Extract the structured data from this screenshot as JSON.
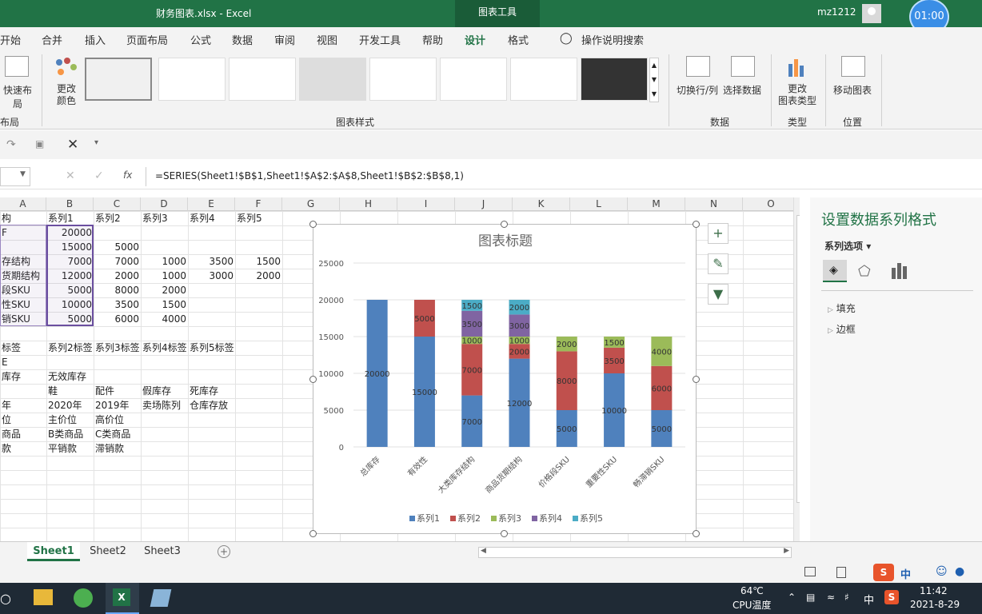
{
  "window": {
    "file_title": "财务图表.xlsx  -  Excel",
    "context_tool": "图表工具",
    "user": "mz1212",
    "timer": "01:00"
  },
  "menu": {
    "items": [
      "开始",
      "插入",
      "页面布局",
      "公式",
      "数据",
      "审阅",
      "视图",
      "开发工具",
      "帮助",
      "设计",
      "格式"
    ],
    "file_item": "开始",
    "merge_item": "合并",
    "tell_me": "操作说明搜索",
    "active": "设计"
  },
  "ribbon": {
    "quick_layout": "快速布局",
    "quick_layout_group": "布局",
    "change_colors": "更改\n颜色",
    "chart_styles_group": "图表样式",
    "switch_row_col": "切换行/列",
    "select_data": "选择数据",
    "data_group": "数据",
    "change_type": "更改\n图表类型",
    "type_group": "类型",
    "move_chart": "移动图表",
    "location_group": "位置"
  },
  "formula": {
    "text": "=SERIES(Sheet1!$B$1,Sheet1!$A$2:$A$8,Sheet1!$B$2:$B$8,1)"
  },
  "columns": [
    "A",
    "B",
    "C",
    "D",
    "E",
    "F",
    "G",
    "H",
    "I",
    "J",
    "K",
    "L",
    "M",
    "N",
    "O"
  ],
  "grid": {
    "rows": [
      [
        "构",
        "系列1",
        "系列2",
        "系列3",
        "系列4",
        "系列5"
      ],
      [
        "F",
        "20000",
        "",
        "",
        "",
        ""
      ],
      [
        "",
        "15000",
        "5000",
        "",
        "",
        ""
      ],
      [
        "存结构",
        "7000",
        "7000",
        "1000",
        "3500",
        "1500"
      ],
      [
        "货期结构",
        "12000",
        "2000",
        "1000",
        "3000",
        "2000"
      ],
      [
        "段SKU",
        "5000",
        "8000",
        "2000",
        "",
        ""
      ],
      [
        "性SKU",
        "10000",
        "3500",
        "1500",
        "",
        ""
      ],
      [
        "销SKU",
        "5000",
        "6000",
        "4000",
        "",
        ""
      ],
      [
        "",
        "",
        "",
        "",
        "",
        ""
      ],
      [
        "标签",
        "系列2标签",
        "系列3标签",
        "系列4标签",
        "系列5标签",
        ""
      ],
      [
        "E",
        "",
        "",
        "",
        "",
        ""
      ],
      [
        "库存",
        "无效库存",
        "",
        "",
        "",
        ""
      ],
      [
        "",
        "鞋",
        "配件",
        "假库存",
        "死库存",
        ""
      ],
      [
        "年",
        "2020年",
        "2019年",
        "卖场陈列",
        "仓库存放",
        ""
      ],
      [
        "位",
        "主价位",
        "高价位",
        "",
        "",
        ""
      ],
      [
        "商品",
        "B类商品",
        "C类商品",
        "",
        "",
        ""
      ],
      [
        "款",
        "平销款",
        "滞销款",
        "",
        "",
        ""
      ]
    ]
  },
  "chart_data": {
    "type": "bar",
    "stacked": true,
    "title": "图表标题",
    "categories": [
      "总库存",
      "有效性",
      "大类库存结构",
      "商品货期结构",
      "价格段SKU",
      "重要性SKU",
      "畅滞销SKU"
    ],
    "series": [
      {
        "name": "系列1",
        "values": [
          20000,
          15000,
          7000,
          12000,
          5000,
          10000,
          5000
        ],
        "color": "#4f81bd"
      },
      {
        "name": "系列2",
        "values": [
          0,
          5000,
          7000,
          2000,
          8000,
          3500,
          6000
        ],
        "color": "#c0504d"
      },
      {
        "name": "系列3",
        "values": [
          0,
          0,
          1000,
          1000,
          2000,
          1500,
          4000
        ],
        "color": "#9bbb59"
      },
      {
        "name": "系列4",
        "values": [
          0,
          0,
          3500,
          3000,
          0,
          0,
          0
        ],
        "color": "#8064a2"
      },
      {
        "name": "系列5",
        "values": [
          0,
          0,
          1500,
          2000,
          0,
          0,
          0
        ],
        "color": "#4bacc6"
      }
    ],
    "y_ticks": [
      "0",
      "5000",
      "10000",
      "15000",
      "20000",
      "25000"
    ],
    "ylim": [
      0,
      25000
    ],
    "grid": true,
    "legend": "bottom"
  },
  "panel": {
    "title": "设置数据系列格式",
    "options": "系列选项",
    "fill": "填充",
    "border": "边框"
  },
  "sheets": {
    "tabs": [
      "Sheet1",
      "Sheet2",
      "Sheet3"
    ],
    "active": "Sheet1"
  },
  "taskbar": {
    "temp": "64℃",
    "temp_label": "CPU温度",
    "ime": "中",
    "time": "11:42",
    "date": "2021-8-29"
  }
}
